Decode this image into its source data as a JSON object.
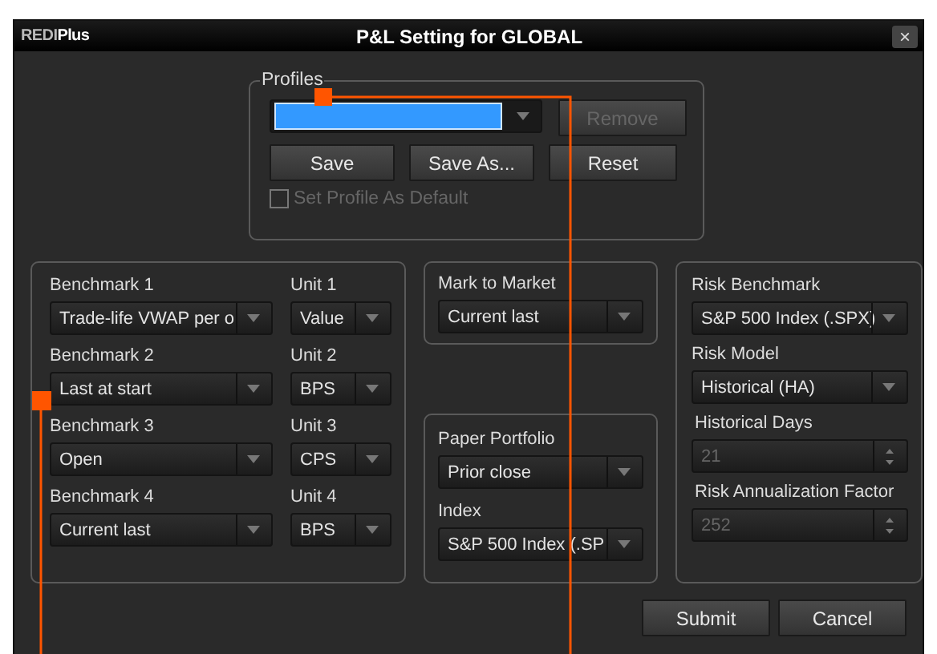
{
  "window": {
    "logo": {
      "part_1": "REDI",
      "part_2": "Plus"
    },
    "title": "P&L Setting for GLOBAL",
    "close": "×"
  },
  "profiles": {
    "label": "Profiles",
    "selector": {
      "highlighted": true
    },
    "buttons": [
      {
        "label": "Remove",
        "disabled": true
      },
      {
        "label": "Save",
        "disabled": false
      },
      {
        "label": "Save As...",
        "disabled": false
      },
      {
        "label": "Reset",
        "disabled": false
      }
    ],
    "default_checkbox": {
      "label": "Set Profile As Default",
      "checked": false,
      "disabled": true
    }
  },
  "benchmarks": [
    {
      "label": "Benchmark 1",
      "value": "Trade-life VWAP per o",
      "unit_label": "Unit 1",
      "unit_value": "Value"
    },
    {
      "label": "Benchmark 2",
      "value": "Last at start",
      "unit_label": "Unit 2",
      "unit_value": "BPS"
    },
    {
      "label": "Benchmark 3",
      "value": "Open",
      "unit_label": "Unit 3",
      "unit_value": "CPS"
    },
    {
      "label": "Benchmark 4",
      "value": "Current last",
      "unit_label": "Unit 4",
      "unit_value": "BPS"
    }
  ],
  "mark_to_market": {
    "label": "Mark to Market",
    "value": "Current last"
  },
  "paper_portfolio": {
    "label": "Paper Portfolio",
    "value": "Prior close",
    "index_label": "Index",
    "index_value": "S&P 500 Index (.SP"
  },
  "risk": [
    {
      "kind": "dropdown",
      "label": "Risk Benchmark",
      "value": "S&P 500 Index (.SPX)",
      "disabled": false
    },
    {
      "kind": "dropdown",
      "label": "Risk Model",
      "value": "Historical (HA)",
      "disabled": false
    },
    {
      "kind": "spinner",
      "label": "Historical Days",
      "value": "21",
      "disabled": true
    },
    {
      "kind": "spinner",
      "label": "Risk Annualization Factor",
      "value": "252",
      "disabled": true
    }
  ],
  "buttons": [
    {
      "label": "Submit"
    },
    {
      "label": "Cancel"
    }
  ]
}
